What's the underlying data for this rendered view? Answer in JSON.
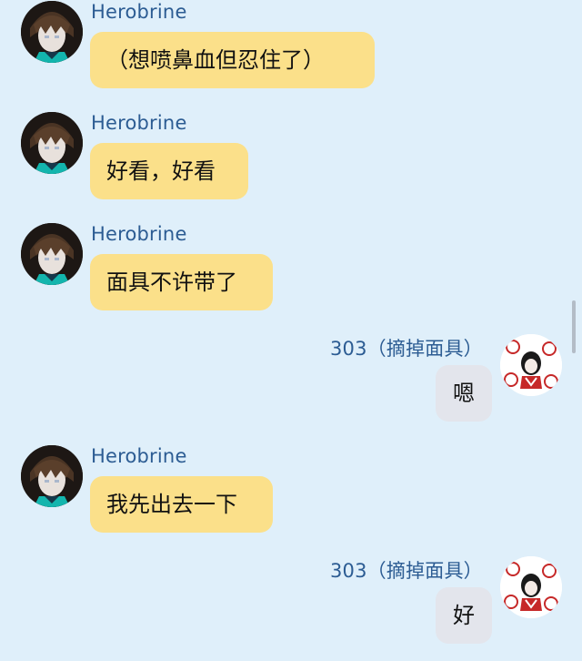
{
  "colors": {
    "background": "#dfeffa",
    "name": "#2c5c93",
    "left_bubble": "#fbe08a",
    "right_bubble": "#e3e5ec"
  },
  "messages": [
    {
      "sender": "Herobrine",
      "text": "（想喷鼻血但忍住了）",
      "side": "left",
      "avatar": "herobrine-avatar"
    },
    {
      "sender": "Herobrine",
      "text": "好看，好看",
      "side": "left",
      "avatar": "herobrine-avatar"
    },
    {
      "sender": "Herobrine",
      "text": "面具不许带了",
      "side": "left",
      "avatar": "herobrine-avatar"
    },
    {
      "sender": "303（摘掉面具）",
      "text": "嗯",
      "side": "right",
      "avatar": "303-avatar"
    },
    {
      "sender": "Herobrine",
      "text": "我先出去一下",
      "side": "left",
      "avatar": "herobrine-avatar"
    },
    {
      "sender": "303（摘掉面具）",
      "text": "好",
      "side": "right",
      "avatar": "303-avatar"
    }
  ]
}
